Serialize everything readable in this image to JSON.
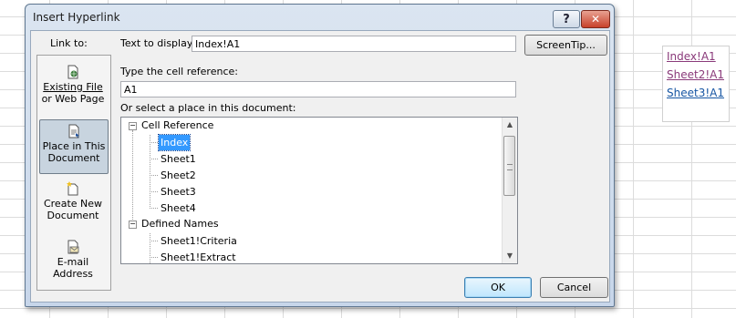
{
  "dialog": {
    "title": "Insert Hyperlink",
    "help_label": "?",
    "close_label": "✕"
  },
  "link_to": {
    "label": "Link to:",
    "items": [
      {
        "line1": "Existing File",
        "line2": "or Web Page",
        "icon": "existing-file-icon"
      },
      {
        "line1": "Place in This",
        "line2": "Document",
        "icon": "place-in-document-icon",
        "selected": true
      },
      {
        "line1": "Create New",
        "line2": "Document",
        "icon": "create-new-document-icon"
      },
      {
        "line1": "E-mail",
        "line2": "Address",
        "icon": "email-icon"
      }
    ]
  },
  "text_to_display": {
    "label": "Text to display:",
    "value": "Index!A1"
  },
  "screentip_label": "ScreenTip...",
  "cell_reference": {
    "label": "Type the cell reference:",
    "value": "A1"
  },
  "place_label": "Or select a place in this document:",
  "tree": {
    "cell_reference_label": "Cell Reference",
    "sheets": [
      "Index",
      "Sheet1",
      "Sheet2",
      "Sheet3",
      "Sheet4"
    ],
    "selected_sheet": "Index",
    "defined_names_label": "Defined Names",
    "names": [
      "Sheet1!Criteria",
      "Sheet1!Extract"
    ],
    "expander_symbol": "−"
  },
  "buttons": {
    "ok": "OK",
    "cancel": "Cancel"
  },
  "worksheet_links": [
    "Index!A1",
    "Sheet2!A1",
    "Sheet3!A1"
  ],
  "colors": {
    "visited_link": "#8a3a7a",
    "link": "#1756a3",
    "selection": "#3399ff"
  }
}
